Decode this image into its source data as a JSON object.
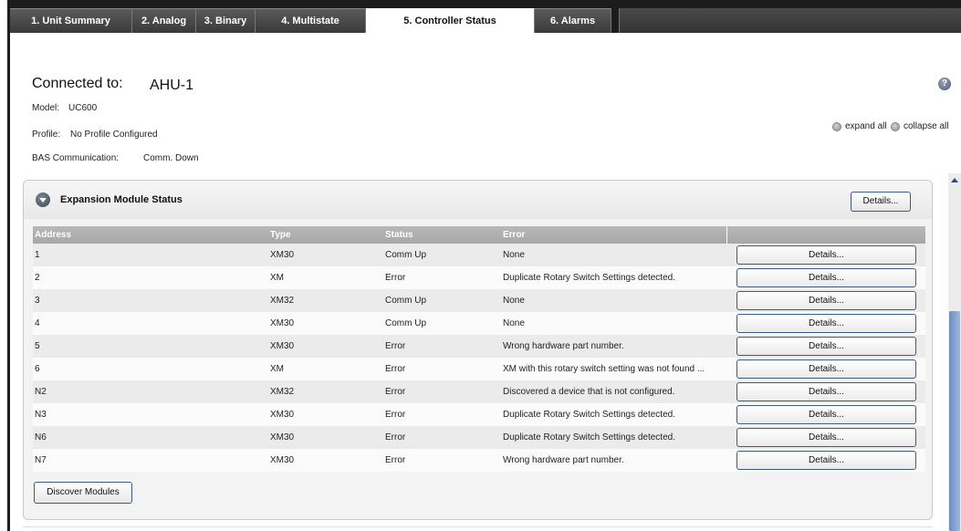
{
  "tabs": [
    {
      "label": "1. Unit Summary",
      "active": false
    },
    {
      "label": "2. Analog",
      "active": false
    },
    {
      "label": "3. Binary",
      "active": false
    },
    {
      "label": "4. Multistate",
      "active": false
    },
    {
      "label": "5. Controller Status",
      "active": true
    },
    {
      "label": "6. Alarms",
      "active": false
    }
  ],
  "header": {
    "connected_label": "Connected to:",
    "connected_value": "AHU-1",
    "model_label": "Model:",
    "model_value": "UC600",
    "profile_label": "Profile:",
    "profile_value": "No Profile Configured",
    "bas_label": "BAS Communication:",
    "bas_value": "Comm. Down",
    "help_icon": "?"
  },
  "options": {
    "expand_all": "expand all",
    "collapse_all": "collapse all"
  },
  "panel": {
    "title": "Expansion Module Status",
    "details_label": "Details...",
    "discover_label": "Discover Modules",
    "columns": [
      "Address",
      "Type",
      "Status",
      "Error"
    ],
    "rows": [
      {
        "address": "1",
        "type": "XM30",
        "status": "Comm Up",
        "error": "None",
        "action": "Details..."
      },
      {
        "address": "2",
        "type": "XM",
        "status": "Error",
        "error": "Duplicate Rotary Switch Settings detected.",
        "action": "Details..."
      },
      {
        "address": "3",
        "type": "XM32",
        "status": "Comm Up",
        "error": "None",
        "action": "Details..."
      },
      {
        "address": "4",
        "type": "XM30",
        "status": "Comm Up",
        "error": "None",
        "action": "Details..."
      },
      {
        "address": "5",
        "type": "XM30",
        "status": "Error",
        "error": "Wrong hardware part number.",
        "action": "Details..."
      },
      {
        "address": "6",
        "type": "XM",
        "status": "Error",
        "error": "XM with this rotary switch setting was not found ...",
        "action": "Details..."
      },
      {
        "address": "N2",
        "type": "XM32",
        "status": "Error",
        "error": "Discovered a device that is not configured.",
        "action": "Details..."
      },
      {
        "address": "N3",
        "type": "XM30",
        "status": "Error",
        "error": "Duplicate Rotary Switch Settings detected.",
        "action": "Details..."
      },
      {
        "address": "N6",
        "type": "XM30",
        "status": "Error",
        "error": "Duplicate Rotary Switch Settings detected.",
        "action": "Details..."
      },
      {
        "address": "N7",
        "type": "XM30",
        "status": "Error",
        "error": "Wrong hardware part number.",
        "action": "Details..."
      }
    ]
  },
  "colors": {
    "tabbar": "#1c1c1c",
    "header_row": "#a7a7a7",
    "button_border": "#3a5a8a",
    "scroll_thumb": "#7fa0d0"
  }
}
